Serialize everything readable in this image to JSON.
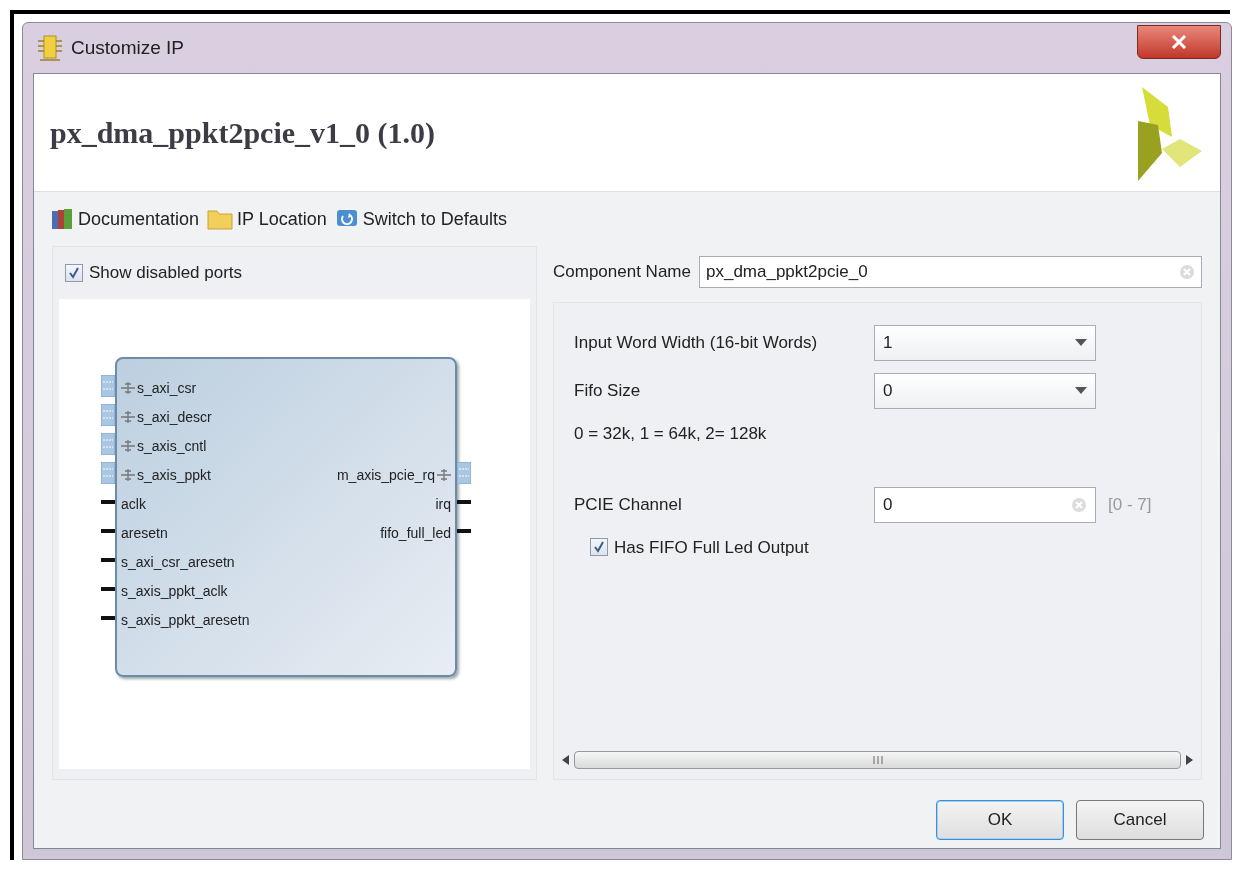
{
  "window": {
    "title": "Customize IP"
  },
  "header": {
    "title": "px_dma_ppkt2pcie_v1_0 (1.0)"
  },
  "toolbar": [
    {
      "label": "Documentation",
      "kind": "book"
    },
    {
      "label": "IP Location",
      "kind": "folder"
    },
    {
      "label": "Switch to Defaults",
      "kind": "refresh"
    }
  ],
  "symbol_panel": {
    "show_disabled_ports": {
      "label": "Show disabled ports",
      "checked": true
    },
    "left_ports": [
      {
        "name": "s_axi_csr",
        "kind": "bus"
      },
      {
        "name": "s_axi_descr",
        "kind": "bus"
      },
      {
        "name": "s_axis_cntl",
        "kind": "bus"
      },
      {
        "name": "s_axis_ppkt",
        "kind": "bus"
      },
      {
        "name": "aclk",
        "kind": "wire"
      },
      {
        "name": "aresetn",
        "kind": "wire"
      },
      {
        "name": "s_axi_csr_aresetn",
        "kind": "wire"
      },
      {
        "name": "s_axis_ppkt_aclk",
        "kind": "wire"
      },
      {
        "name": "s_axis_ppkt_aresetn",
        "kind": "wire"
      }
    ],
    "right_ports": [
      {
        "name": "m_axis_pcie_rq",
        "kind": "bus"
      },
      {
        "name": "irq",
        "kind": "wire"
      },
      {
        "name": "fifo_full_led",
        "kind": "wire"
      }
    ]
  },
  "component_name": {
    "label": "Component Name",
    "value": "px_dma_ppkt2pcie_0"
  },
  "parameters": [
    {
      "kind": "dropdown",
      "label": "Input Word Width (16-bit Words)",
      "value": "1"
    },
    {
      "kind": "dropdown",
      "label": "Fifo Size",
      "value": "0"
    },
    {
      "kind": "note",
      "label": "0 = 32k, 1 = 64k, 2= 128k"
    },
    {
      "kind": "number",
      "label": "PCIE Channel",
      "value": "0",
      "range": "[0 - 7]"
    },
    {
      "kind": "checkbox",
      "label": "Has FIFO Full Led Output",
      "checked": true
    }
  ],
  "buttons": [
    "OK",
    "Cancel"
  ]
}
